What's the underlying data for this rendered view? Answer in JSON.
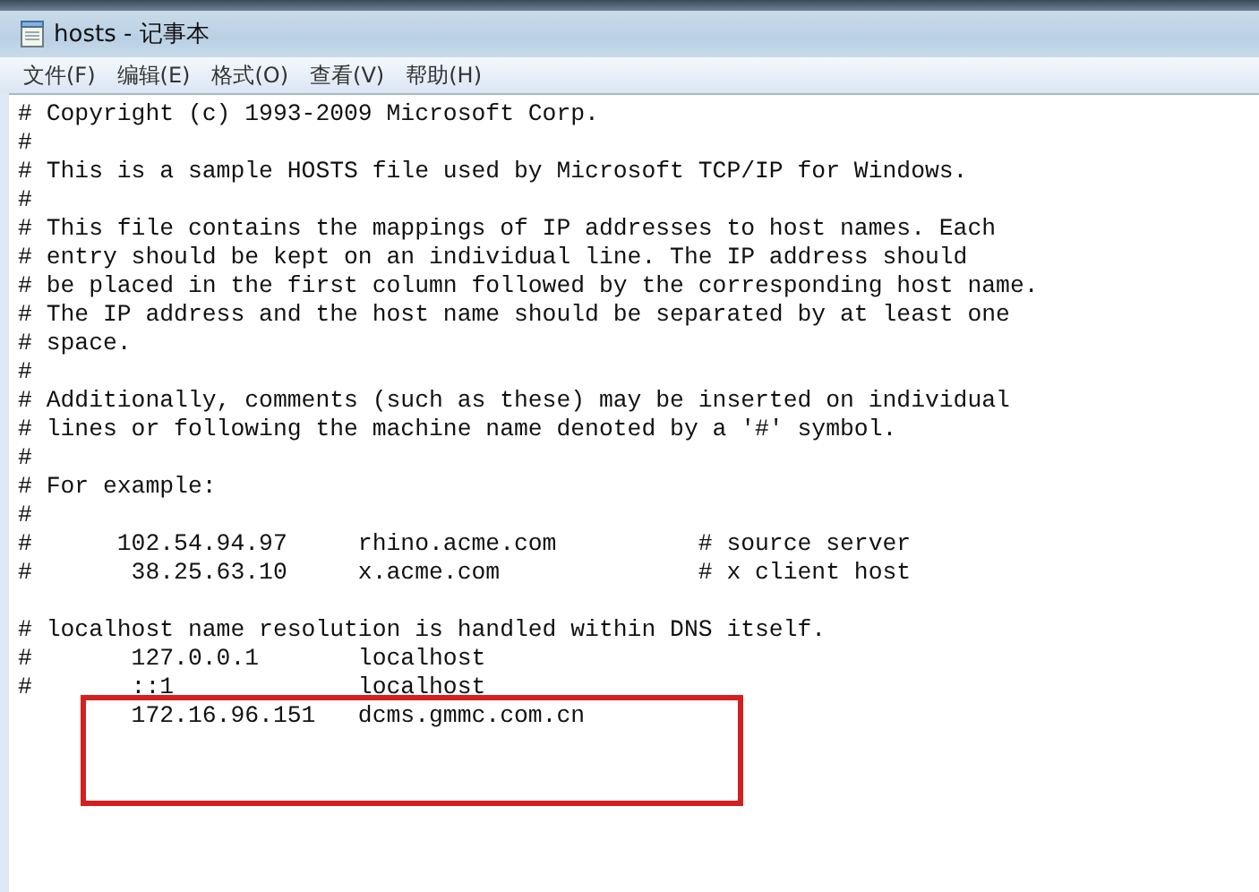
{
  "window": {
    "title": "hosts - 记事本"
  },
  "menu": [
    "文件(F)",
    "编辑(E)",
    "格式(O)",
    "查看(V)",
    "帮助(H)"
  ],
  "editor": {
    "blocks": [
      [
        "# Copyright (c) 1993-2009 Microsoft Corp.",
        "#",
        "# This is a sample HOSTS file used by Microsoft TCP/IP for Windows.",
        "#",
        "# This file contains the mappings of IP addresses to host names. Each",
        "# entry should be kept on an individual line. The IP address should",
        "# be placed in the first column followed by the corresponding host name.",
        "# The IP address and the host name should be separated by at least one",
        "# space.",
        "#",
        "# Additionally, comments (such as these) may be inserted on individual",
        "# lines or following the machine name denoted by a '#' symbol.",
        "#",
        "# For example:",
        "#",
        "#      102.54.94.97     rhino.acme.com          # source server",
        "#       38.25.63.10     x.acme.com              # x client host"
      ],
      [
        "# localhost name resolution is handled within DNS itself.",
        "#       127.0.0.1       localhost",
        "#       ::1             localhost",
        "        172.16.96.151   dcms.gmmc.com.cn"
      ]
    ]
  }
}
